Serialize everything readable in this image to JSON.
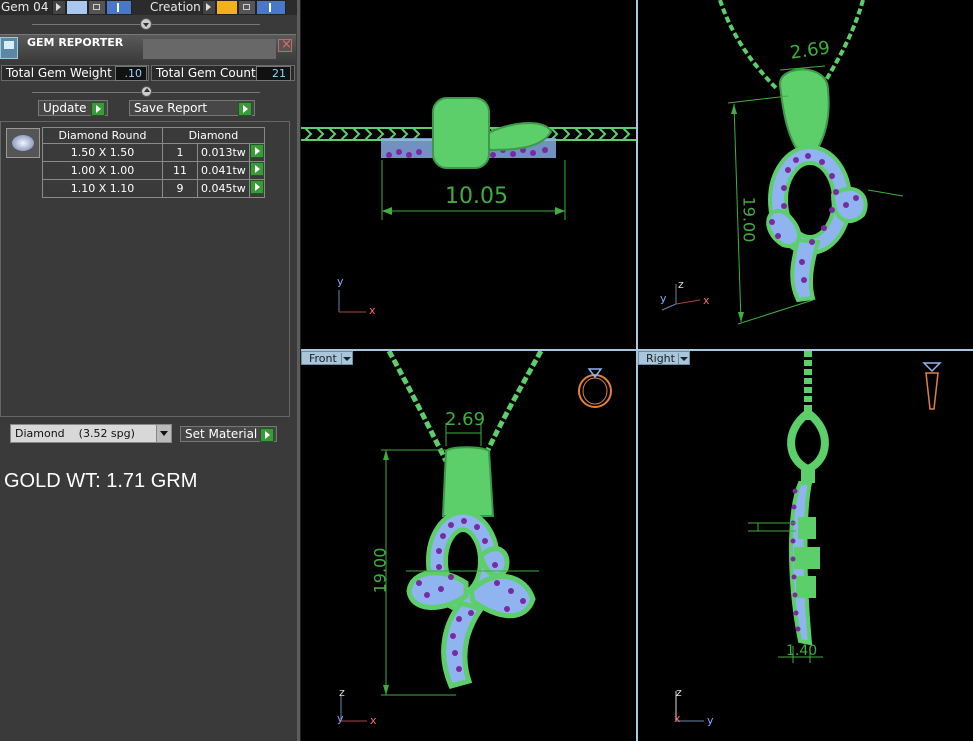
{
  "toolbar": {
    "gem_label": "Gem 04",
    "creation_label": "Creation"
  },
  "gem_reporter": {
    "title": "GEM REPORTER",
    "total_weight_label": "Total Gem Weight",
    "total_weight_value": ".10",
    "total_count_label": "Total Gem Count",
    "total_count_value": "21",
    "update_label": "Update",
    "save_report_label": "Save Report",
    "table_headers": [
      "Diamond Round",
      "Diamond"
    ],
    "rows": [
      {
        "size": "1.50 X 1.50",
        "count": "1",
        "weight": "0.013tw"
      },
      {
        "size": "1.00 X 1.00",
        "count": "11",
        "weight": "0.041tw"
      },
      {
        "size": "1.10 X 1.10",
        "count": "9",
        "weight": "0.045tw"
      }
    ]
  },
  "material": {
    "selected": "Diamond    (3.52 spg)",
    "set_material_label": "Set Material"
  },
  "gold_weight": "GOLD WT: 1.71 GRM",
  "viewports": {
    "front_label": "Front",
    "right_label": "Right",
    "top_dimension": "10.05",
    "persp_width": "2.69",
    "persp_height": "19.00",
    "front_width": "2.69",
    "front_height": "19.00",
    "right_depth": "1.40"
  },
  "axes": {
    "top": [
      "y",
      "x"
    ],
    "persp": [
      "z",
      "y",
      "x"
    ],
    "front": [
      "z",
      "y",
      "x"
    ],
    "right": [
      "z",
      "x",
      "y"
    ]
  },
  "colors": {
    "metal": "#5ccf6a",
    "gem": "#8fb4f0",
    "gem_dot": "#7a2aa0",
    "dimension": "#3fae3f"
  }
}
